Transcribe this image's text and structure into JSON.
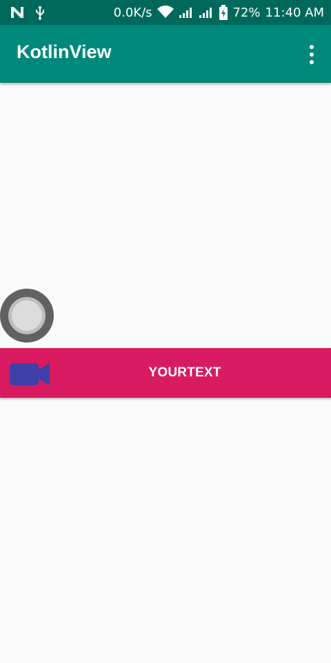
{
  "status_bar": {
    "net_speed": "0.0K/s",
    "battery_percent": "72%",
    "time": "11:40 AM",
    "icons": [
      "n-icon",
      "usb-icon",
      "wifi-icon",
      "signal-icon",
      "signal-icon",
      "battery-charging-icon"
    ]
  },
  "toolbar": {
    "title": "KotlinView",
    "menu_icon": "more-vert-icon"
  },
  "action_bar": {
    "label": "YOURTEXT",
    "icon": "video-camera-icon"
  },
  "colors": {
    "status_bar": "#00695c",
    "toolbar": "#00897b",
    "accent": "#d81b60",
    "video_icon": "#3f3fa8",
    "record_ring": "#616161"
  }
}
